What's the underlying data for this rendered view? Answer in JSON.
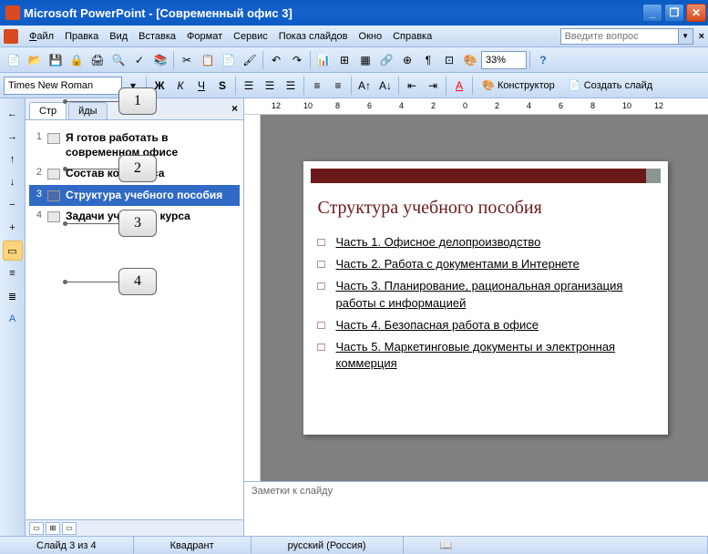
{
  "titlebar": {
    "app": "Microsoft PowerPoint",
    "doc": "[Современный офис 3]"
  },
  "menu": {
    "file": "Файл",
    "edit": "Правка",
    "view": "Вид",
    "insert": "Вставка",
    "format": "Формат",
    "tools": "Сервис",
    "slideshow": "Показ слайдов",
    "window": "Окно",
    "help": "Справка"
  },
  "helpbox_placeholder": "Введите вопрос",
  "toolbar": {
    "zoom": "33%",
    "font": "Times New Roman",
    "designer": "Конструктор",
    "newslide": "Создать слайд"
  },
  "tabs": {
    "outline": "Стр",
    "slides": "йды"
  },
  "slides": [
    {
      "num": "1",
      "title": "Я готов работать в современном офисе"
    },
    {
      "num": "2",
      "title": "Состав комплекса"
    },
    {
      "num": "3",
      "title": "Структура учебного пособия"
    },
    {
      "num": "4",
      "title": "Задачи учебного курса"
    }
  ],
  "selected_partial": "чебного пособия",
  "slide_content": {
    "title": "Структура учебного пособия",
    "items": [
      "Часть 1. Офисное делопроизводство",
      "Часть 2. Работа с документами в Интернете",
      "Часть 3. Планирование, рациональная организация работы с информацией",
      "Часть 4. Безопасная работа в офисе",
      "Часть 5. Маркетинговые документы и электронная коммерция"
    ]
  },
  "notes_placeholder": "Заметки к слайду",
  "status": {
    "slide": "Слайд 3 из 4",
    "template": "Квадрант",
    "lang": "русский (Россия)"
  },
  "callouts": {
    "c1": "1",
    "c2": "2",
    "c3": "3",
    "c4": "4"
  },
  "ruler_nums": [
    "12",
    "10",
    "8",
    "6",
    "4",
    "2",
    "0",
    "2",
    "4",
    "6",
    "8",
    "10",
    "12"
  ]
}
